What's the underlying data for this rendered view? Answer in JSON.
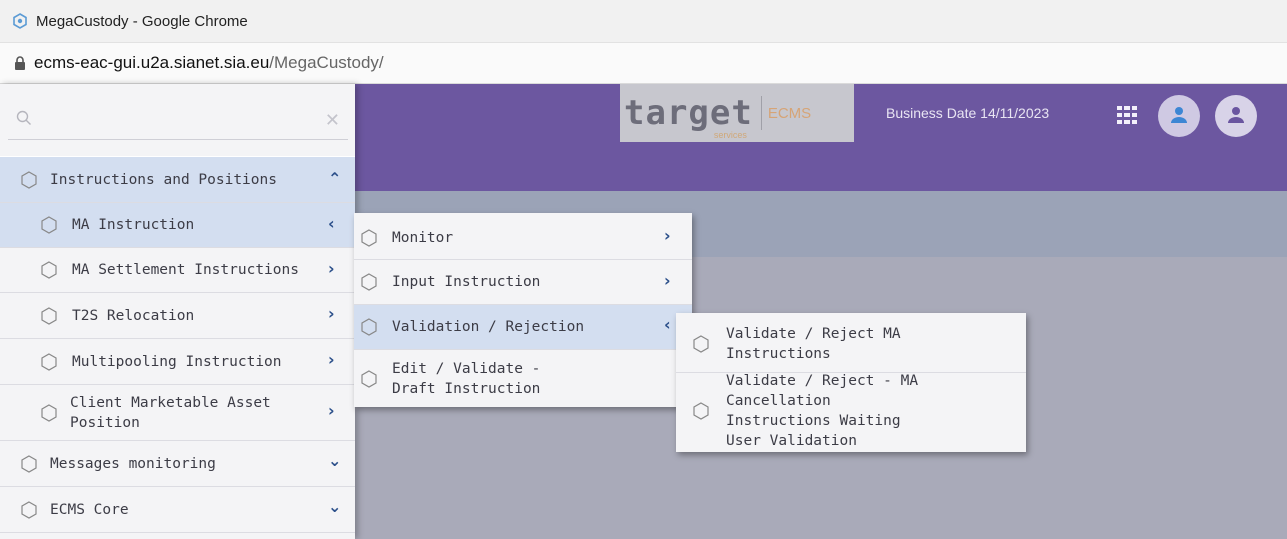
{
  "browser": {
    "window_title": "MegaCustody - Google Chrome",
    "url_host": "ecms-eac-gui.u2a.sianet.sia.eu",
    "url_path": "/MegaCustody/"
  },
  "header": {
    "logo_word": "target",
    "logo_sub": "services",
    "logo_brand": "ECMS",
    "business_date": "Business Date 14/11/2023",
    "header_color": "#6c57a0"
  },
  "sidebar": {
    "search_placeholder": "",
    "items": [
      {
        "label": "Instructions and Positions",
        "state": "expanded"
      },
      {
        "label": "MA Instruction",
        "state": "open"
      },
      {
        "label": "MA Settlement Instructions",
        "state": "closed"
      },
      {
        "label": "T2S Relocation",
        "state": "closed"
      },
      {
        "label": "Multipooling Instruction",
        "state": "closed"
      },
      {
        "label": "Client Marketable Asset Position",
        "state": "closed"
      },
      {
        "label": "Messages monitoring",
        "state": "collapsed"
      },
      {
        "label": "ECMS Core",
        "state": "collapsed"
      }
    ]
  },
  "submenu_ma_instruction": {
    "items": [
      {
        "label": "Monitor"
      },
      {
        "label": "Input Instruction"
      },
      {
        "label": "Validation / Rejection"
      },
      {
        "label": "Edit / Validate - Draft Instruction"
      }
    ]
  },
  "submenu_validation": {
    "items": [
      {
        "label": "Validate / Reject MA Instructions"
      },
      {
        "label": "Validate / Reject - MA Cancellation Instructions Waiting User Validation"
      }
    ]
  },
  "icons": {
    "menu_item": "hexagon-icon",
    "expand": "chevron-down-icon",
    "collapse": "chevron-up-icon",
    "submenu": "chevron-right-icon",
    "submenu_open": "chevron-left-icon",
    "apps": "grid-icon",
    "user": "user-icon"
  }
}
